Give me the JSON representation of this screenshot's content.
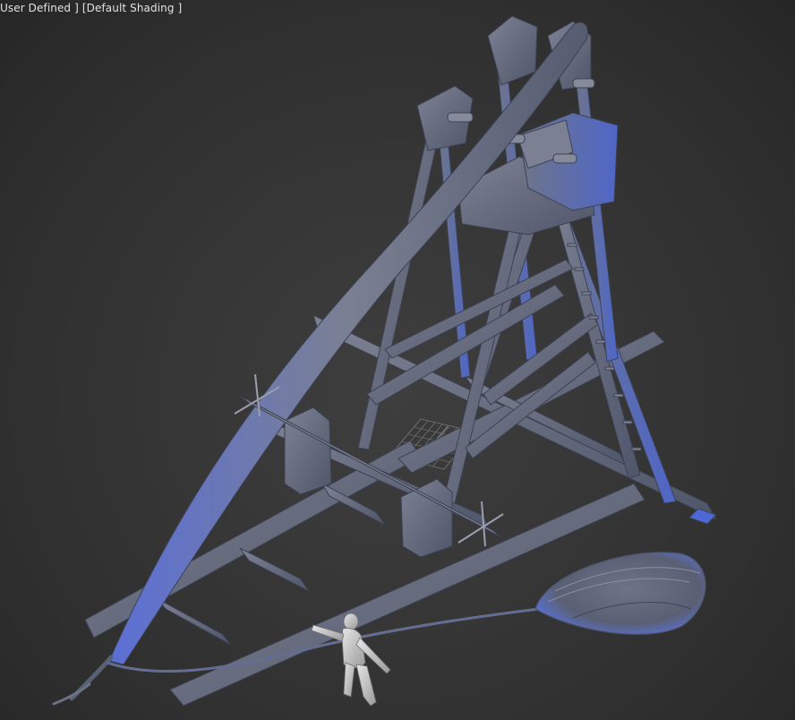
{
  "viewport": {
    "view_menu_label": "User Defined ]",
    "shading_menu_label": "[Default Shading ]",
    "background_color": "#363636"
  },
  "scene": {
    "model": "trebuchet",
    "figure": "human-scale-reference",
    "sling": "sling-pouch",
    "grid": "ground-grid",
    "material_color": "#6a7080",
    "highlight_color": "#5a6fd0"
  }
}
